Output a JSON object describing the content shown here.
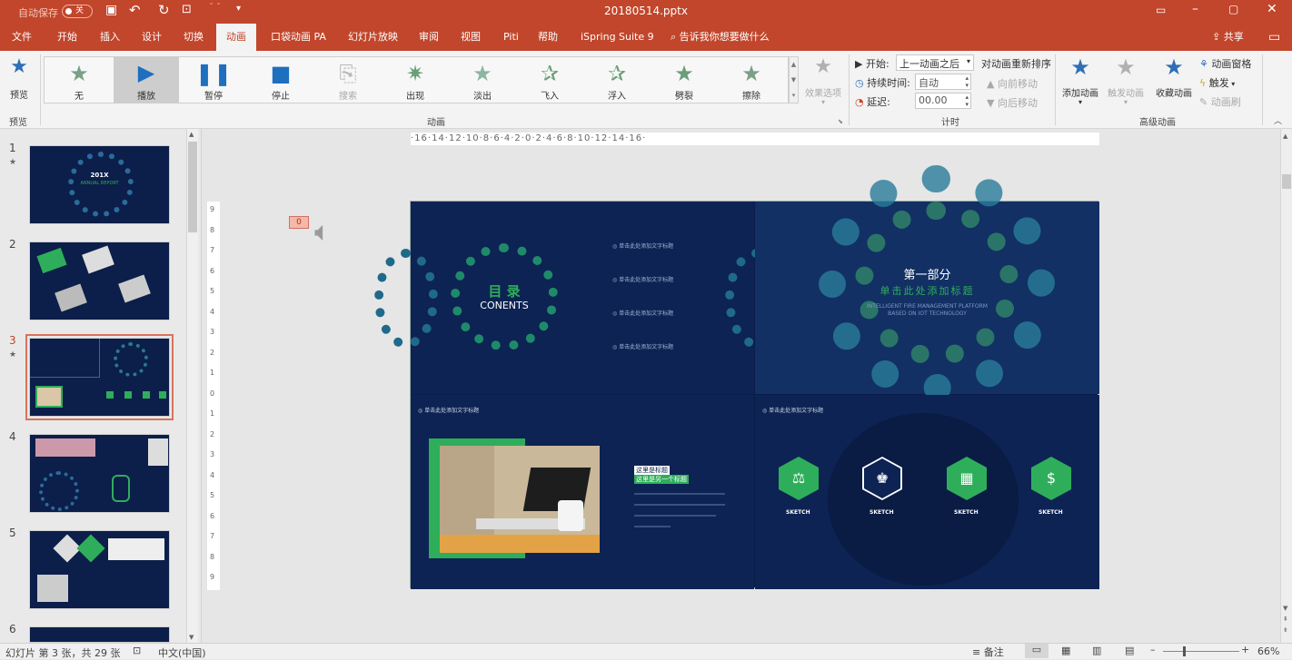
{
  "titlebar": {
    "autosave_label": "自动保存",
    "autosave_state": "关",
    "filename": "20180514.pptx"
  },
  "menu_tabs": [
    "文件",
    "开始",
    "插入",
    "设计",
    "切换",
    "动画",
    "口袋动画 PA",
    "幻灯片放映",
    "审阅",
    "视图",
    "Piti",
    "帮助",
    "iSpring Suite 9"
  ],
  "active_tab": "动画",
  "tell_me": "告诉我你想要做什么",
  "share": "共享",
  "ribbon": {
    "preview_label": "预览",
    "preview_group": "预览",
    "animations": [
      "无",
      "播放",
      "暂停",
      "停止",
      "搜索",
      "出现",
      "淡出",
      "飞入",
      "浮入",
      "劈裂",
      "擦除"
    ],
    "effect_options": "效果选项",
    "animation_group": "动画",
    "timing": {
      "start_label": "开始:",
      "start_value": "上一动画之后",
      "duration_label": "持续时间:",
      "duration_value": "自动",
      "delay_label": "延迟:",
      "delay_value": "00.00",
      "reorder_label": "对动画重新排序",
      "move_earlier": "向前移动",
      "move_later": "向后移动",
      "group": "计时"
    },
    "advanced": {
      "add_animation": "添加动画",
      "trigger_anim": "触发动画",
      "favorite_anim": "收藏动画",
      "anim_pane": "动画窗格",
      "trigger": "触发",
      "anim_painter": "动画刷",
      "group": "高级动画"
    }
  },
  "slides": [
    {
      "num": "1",
      "star": true
    },
    {
      "num": "2",
      "star": false
    },
    {
      "num": "3",
      "star": true
    },
    {
      "num": "4",
      "star": false
    },
    {
      "num": "5",
      "star": false
    },
    {
      "num": "6",
      "star": false
    }
  ],
  "ruler_text": "·16·14·12·10·8·6·4·2·0·2·4·6·8·10·12·14·16·",
  "vruler_labels": [
    "9",
    "8",
    "7",
    "6",
    "5",
    "4",
    "3",
    "2",
    "1",
    "0",
    "1",
    "2",
    "3",
    "4",
    "5",
    "6",
    "7",
    "8",
    "9"
  ],
  "slide": {
    "audio_badge": "0",
    "toc_title": "目 录",
    "toc_sub": "CONENTS",
    "toc_item": "单击此处添加文字标题",
    "toc_count": 4,
    "part_title": "第一部分",
    "part_sub": "单击此处添加标题",
    "part_en1": "INTELLIGENT FIRE MANAGEMENT PLATFORM",
    "part_en2": "BASED ON IOT TECHNOLOGY",
    "q3_title": "单击此处添加文字标题",
    "q3_tag1": "这里是标题",
    "q3_tag2": "这里是另一个标题",
    "q4_title": "单击此处添加文字标题",
    "hex_label": "SKETCH",
    "hex_icons": [
      "⚖",
      "♚",
      "▦",
      "$"
    ]
  },
  "thumb_texts": {
    "t1_title": "201X",
    "t1_sub": "ANNUAL REPORT"
  },
  "statusbar": {
    "slide_info": "幻灯片 第 3 张，共 29 张",
    "language": "中文(中国)",
    "notes": "备注",
    "zoom": "66%"
  },
  "colors": {
    "brand": "#c1462b",
    "slide_bg": "#0b1d4a",
    "accent_green": "#2eae5a",
    "star_green": "#6a9e78",
    "star_blue": "#2f6fb6"
  }
}
